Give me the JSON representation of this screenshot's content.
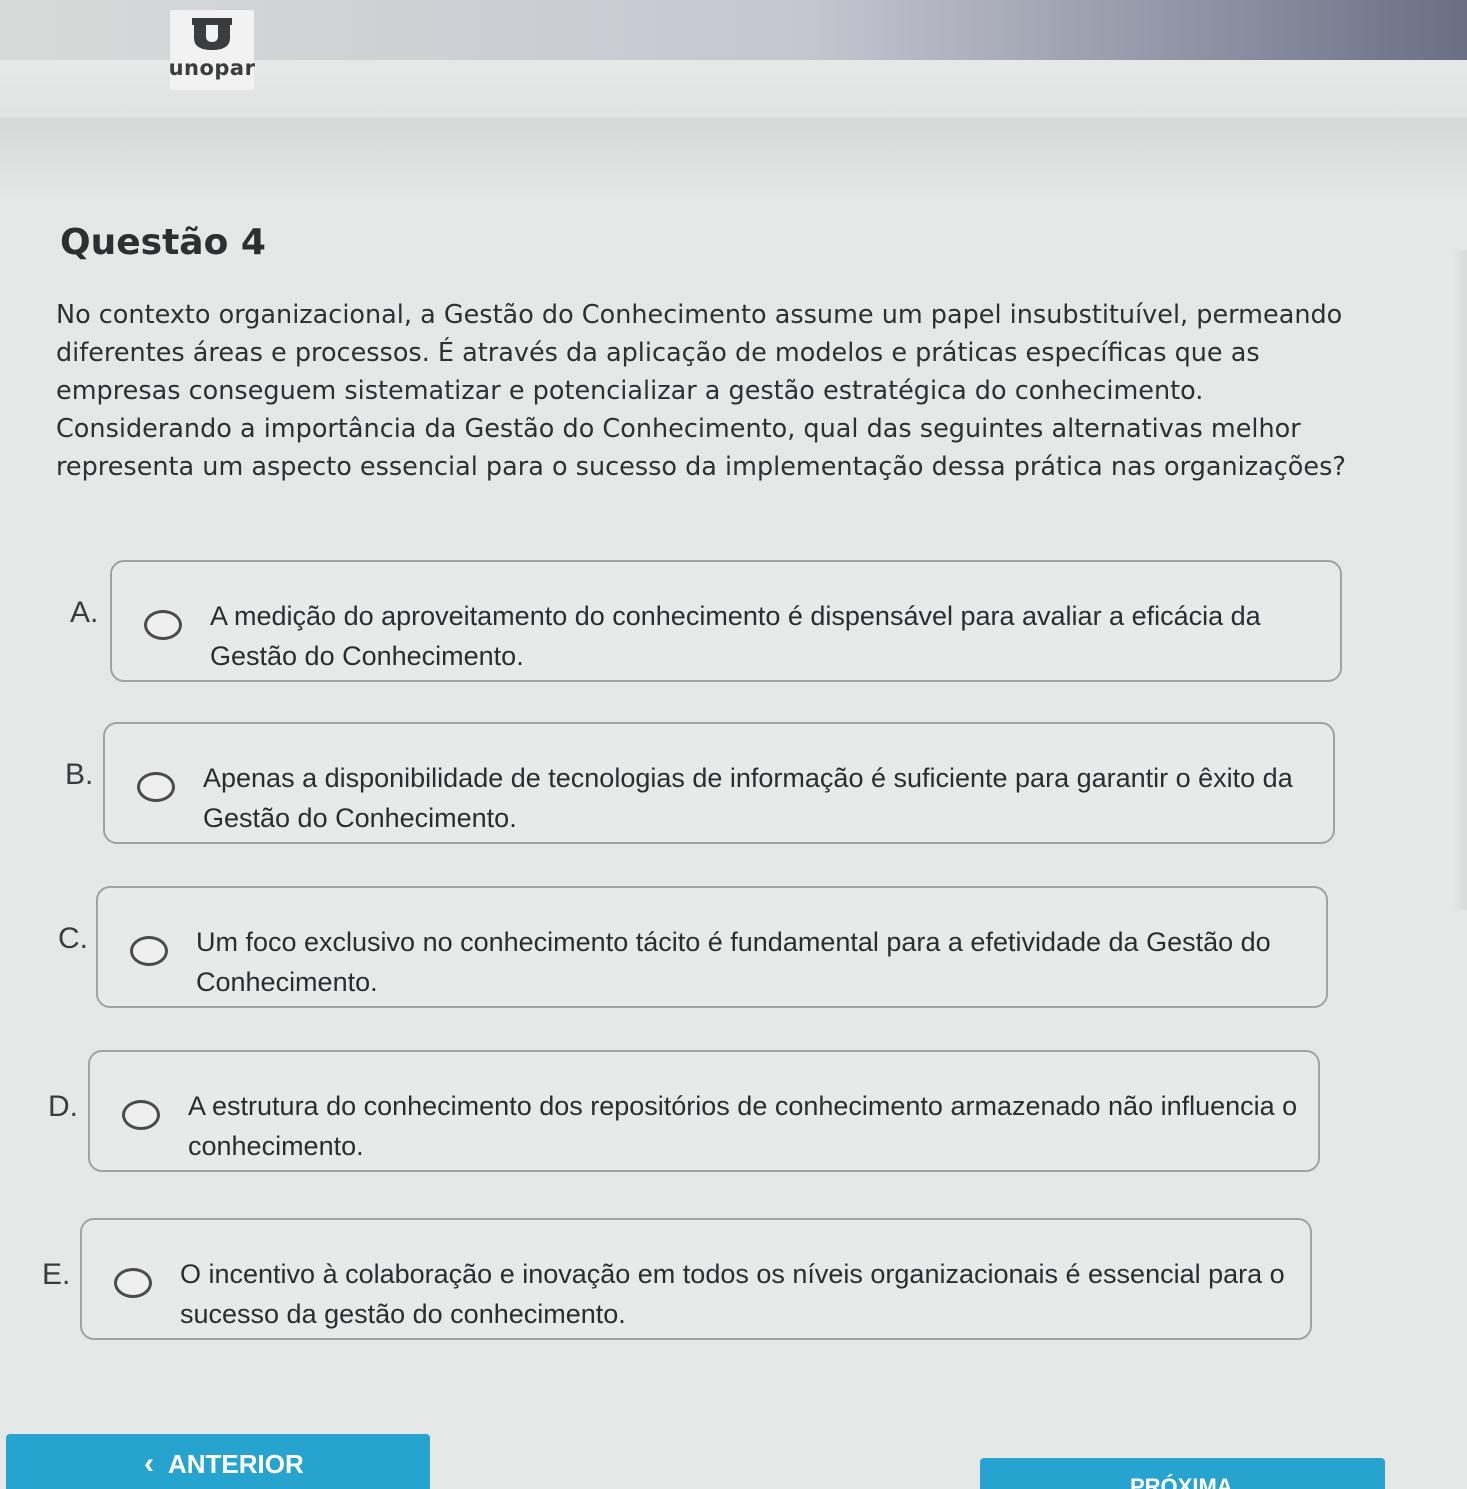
{
  "header": {
    "logo_text": "unopar"
  },
  "question": {
    "title": "Questão 4",
    "stem": "No contexto organizacional, a Gestão do Conhecimento assume um papel insubstituível, permeando diferentes áreas e processos. É através da aplicação de modelos e práticas específicas que as empresas conseguem sistematizar e potencializar a gestão estratégica do conhecimento. Considerando a importância da Gestão do Conhecimento, qual das seguintes alternativas melhor representa um aspecto essencial para o sucesso da implementação dessa prática nas organizações?",
    "options": [
      {
        "letter": "A.",
        "text": "A medição do aproveitamento do conhecimento é dispensável para avaliar a eficácia da Gestão do Conhecimento.",
        "selected": false
      },
      {
        "letter": "B.",
        "text": "Apenas a disponibilidade de tecnologias de informação é suficiente para garantir o êxito da Gestão do Conhecimento.",
        "selected": false
      },
      {
        "letter": "C.",
        "text": "Um foco exclusivo no conhecimento tácito é fundamental para a efetividade da Gestão do Conhecimento.",
        "selected": false
      },
      {
        "letter": "D.",
        "text": "A estrutura do conhecimento dos repositórios de conhecimento armazenado não influencia o conhecimento.",
        "selected": false
      },
      {
        "letter": "E.",
        "text": "O incentivo à colaboração e inovação em todos os níveis organizacionais é essencial para o sucesso da gestão do conhecimento.",
        "selected": false
      }
    ]
  },
  "navigation": {
    "prev_label": "ANTERIOR",
    "next_label": "PRÓXIMA"
  },
  "colors": {
    "accent": "#27a3cf",
    "border": "#9fa3a4",
    "background": "#e6e8e7"
  }
}
